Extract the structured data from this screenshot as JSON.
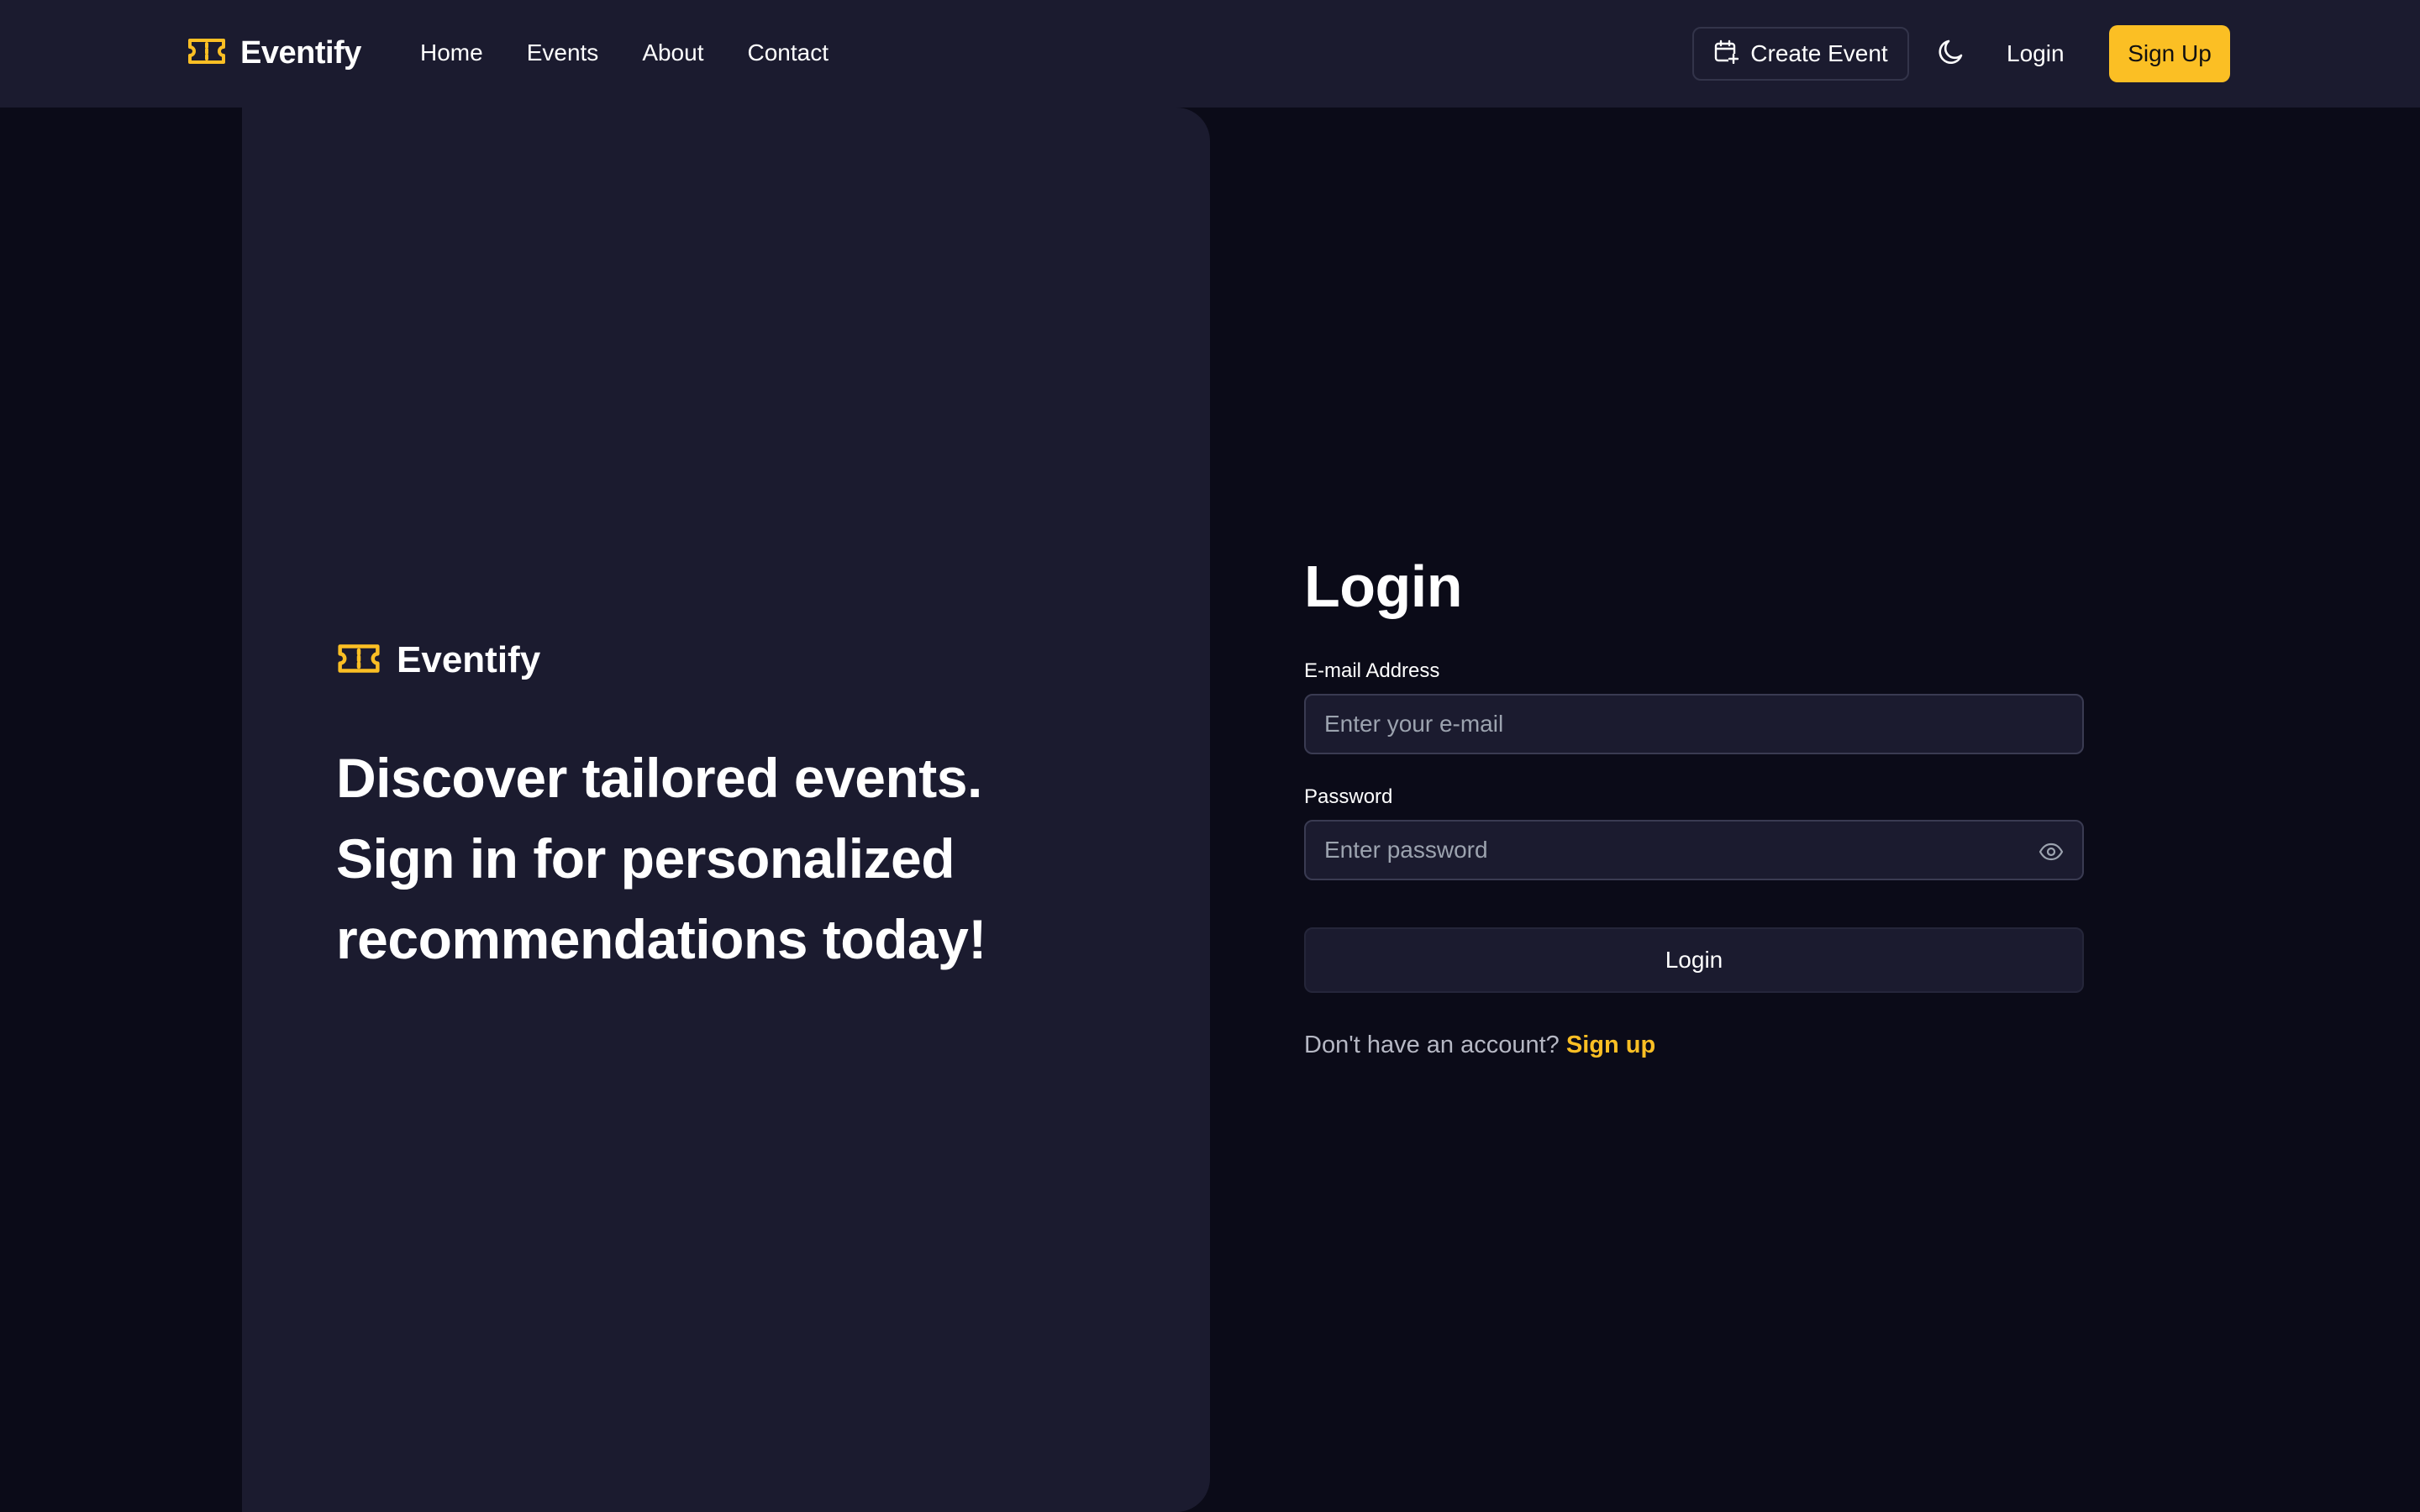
{
  "brand": {
    "name": "Eventify",
    "accent_color": "#fbbf24",
    "logo_icon": "ticket-icon"
  },
  "nav": {
    "links": [
      {
        "label": "Home"
      },
      {
        "label": "Events"
      },
      {
        "label": "About"
      },
      {
        "label": "Contact"
      }
    ],
    "create_event_label": "Create Event",
    "create_event_icon": "calendar-plus-icon",
    "theme_icon": "moon-icon",
    "login_label": "Login",
    "signup_label": "Sign Up"
  },
  "hero": {
    "brand_name": "Eventify",
    "headline_lines": [
      "Discover tailored events.",
      "Sign in for personalized",
      "recommendations today!"
    ]
  },
  "form": {
    "title": "Login",
    "email_label": "E-mail Address",
    "email_placeholder": "Enter your e-mail",
    "email_value": "",
    "password_label": "Password",
    "password_placeholder": "Enter password",
    "password_value": "",
    "password_toggle_icon": "eye-icon",
    "submit_label": "Login",
    "switch_prompt": "Don't have an account?",
    "switch_link": "Sign up"
  },
  "colors": {
    "page_bg": "#0b0b18",
    "panel_bg": "#1b1b2f",
    "accent": "#fbbf24"
  }
}
